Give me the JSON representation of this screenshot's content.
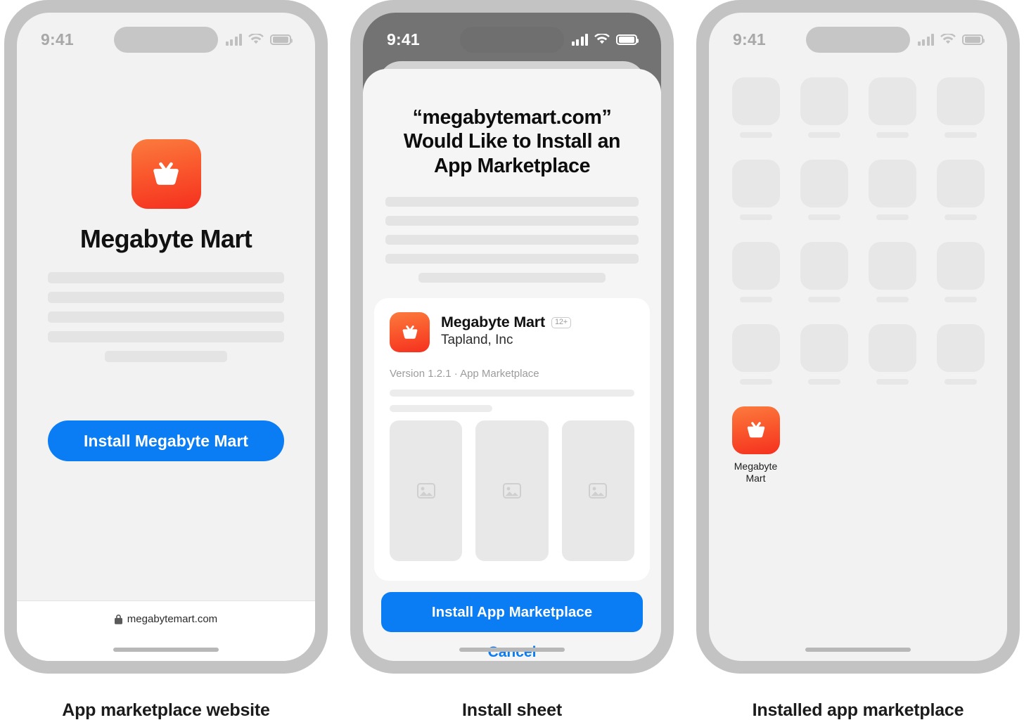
{
  "accent_blue": "#0a7cf4",
  "icon_gradient_from": "#fb7b3e",
  "icon_gradient_to": "#f5301f",
  "panels": [
    {
      "caption": "App marketplace website",
      "status": {
        "time": "9:41",
        "signal_icon": "cellular-bars-icon",
        "wifi_icon": "wifi-icon",
        "battery_icon": "battery-icon"
      },
      "hero": {
        "app_icon_name": "shopping-basket-icon",
        "title": "Megabyte Mart",
        "install_label": "Install Megabyte Mart"
      },
      "urlbar": {
        "lock_icon": "lock-icon",
        "url": "megabytemart.com"
      }
    },
    {
      "caption": "Install sheet",
      "status": {
        "time": "9:41",
        "signal_icon": "cellular-bars-icon",
        "wifi_icon": "wifi-icon",
        "battery_icon": "battery-icon"
      },
      "sheet": {
        "title": "“megabytemart.com” Would Like to Install an App Marketplace",
        "title_lines": [
          "“megabytemart.com”",
          "Would Like to Install an",
          "App Marketplace"
        ],
        "app": {
          "icon_name": "shopping-basket-icon",
          "name": "Megabyte Mart",
          "age_rating": "12+",
          "developer": "Tapland, Inc",
          "version_line": "Version 1.2.1 · App Marketplace",
          "screenshot_placeholder_icon": "image-placeholder-icon",
          "screenshot_count": 3
        },
        "install_label": "Install App Marketplace",
        "cancel_label": "Cancel"
      }
    },
    {
      "caption": "Installed app marketplace",
      "status": {
        "time": "9:41",
        "signal_icon": "cellular-bars-icon",
        "wifi_icon": "wifi-icon",
        "battery_icon": "battery-icon"
      },
      "home": {
        "placeholder_rows": 4,
        "placeholder_cols": 4,
        "installed_app": {
          "icon_name": "shopping-basket-icon",
          "label_line1": "Megabyte",
          "label_line2": "Mart"
        }
      }
    }
  ]
}
